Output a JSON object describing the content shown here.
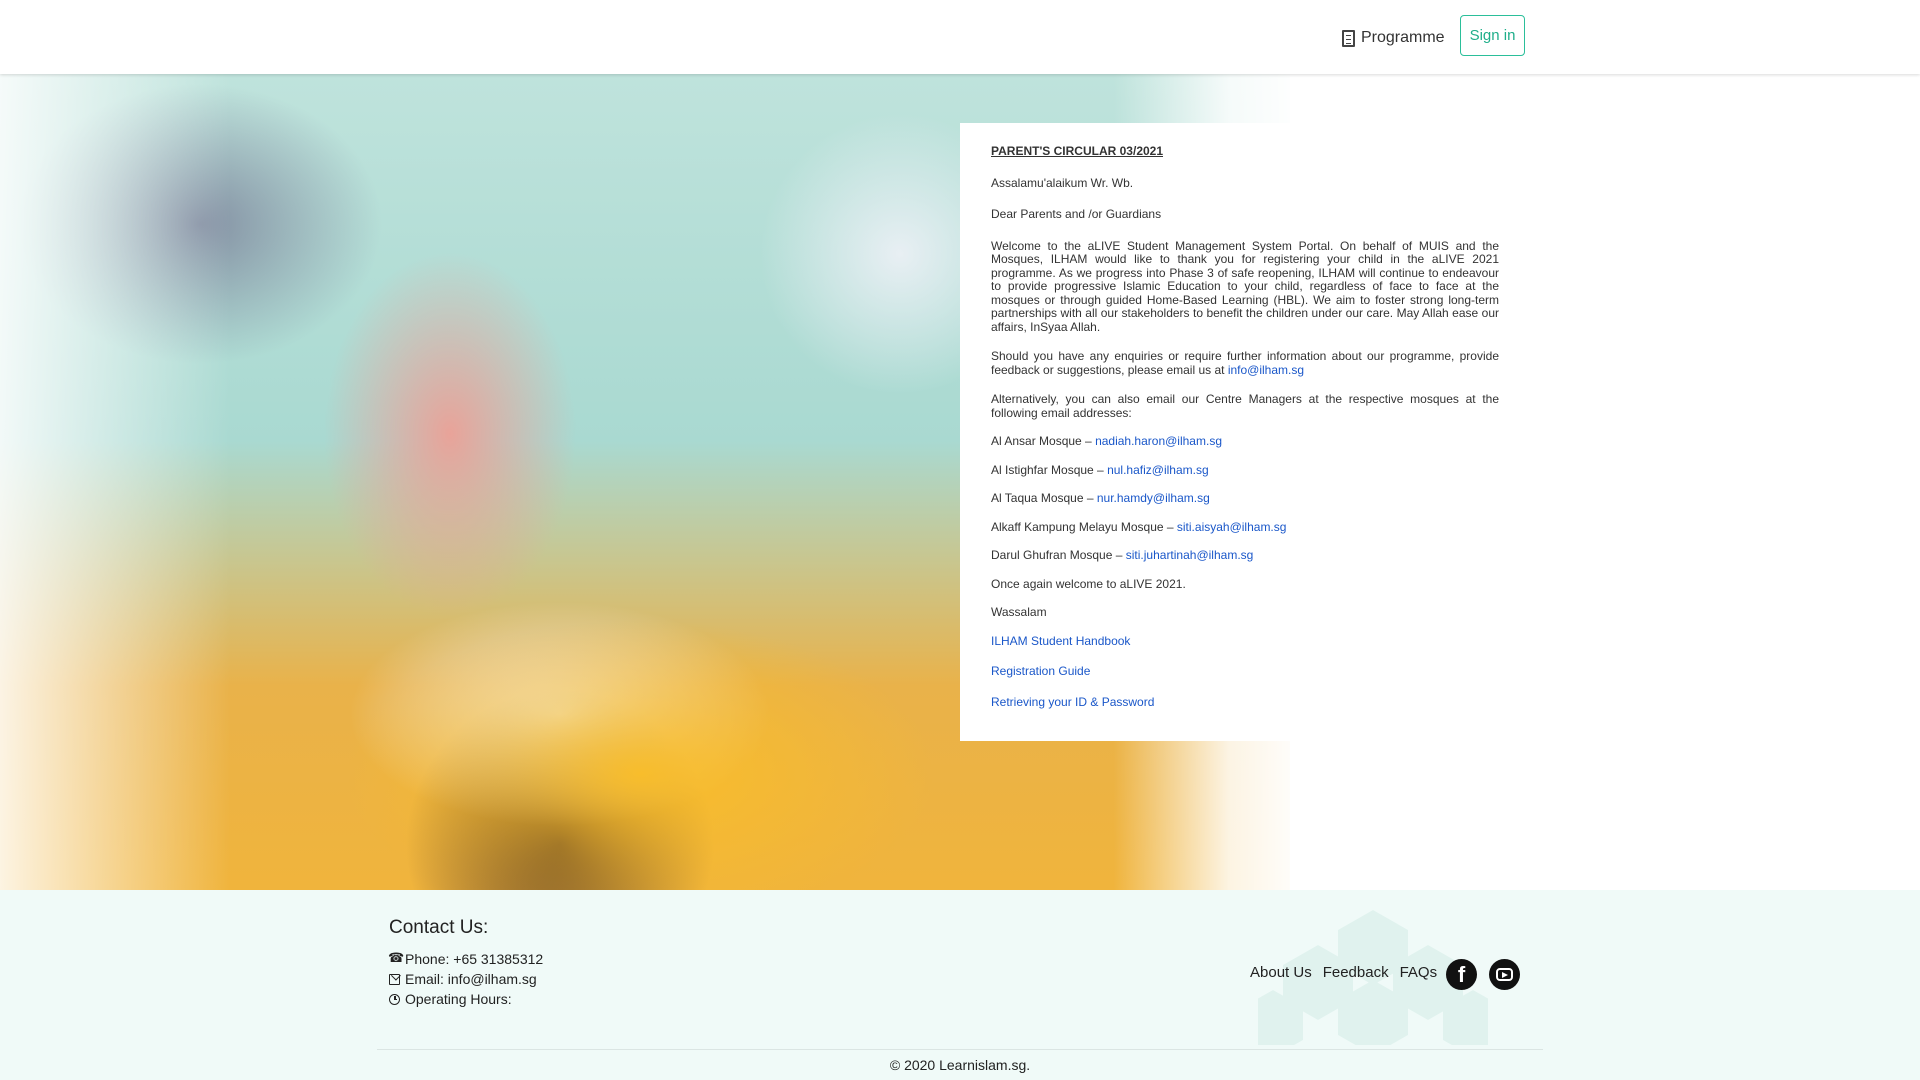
{
  "header": {
    "programme_label": "Programme",
    "signin_label": "Sign in"
  },
  "circular": {
    "title": "PARENT'S CIRCULAR 03/2021",
    "greeting": "Assalamu'alaikum Wr. Wb.",
    "salutation": "Dear Parents and /or Guardians",
    "body": "Welcome to the aLIVE Student Management System Portal. On behalf of MUIS and the Mosques, ILHAM would like to thank you for registering your child in the aLIVE 2021 programme. As we progress into Phase 3 of safe reopening, ILHAM will continue to endeavour to provide progressive Islamic Education to your child, regardless of face to face at the mosques or through guided Home-Based Learning (HBL). We aim to foster strong long-term partnerships with all our stakeholders to benefit the children under our care. May Allah ease our affairs, InSyaa Allah.",
    "enquiry_text": "Should you have any enquiries or require further information about our programme, provide feedback or suggestions, please email us at ",
    "enquiry_email": "info@ilham.sg",
    "alternative_text": "Alternatively, you can also email our Centre Managers at the respective mosques at the following email addresses:",
    "mosques": [
      {
        "name": "Al Ansar Mosque – ",
        "email": "nadiah.haron@ilham.sg"
      },
      {
        "name": "Al Istighfar Mosque – ",
        "email": "nul.hafiz@ilham.sg"
      },
      {
        "name": "Al Taqua Mosque – ",
        "email": "nur.hamdy@ilham.sg"
      },
      {
        "name": "Alkaff Kampung Melayu Mosque – ",
        "email": "siti.aisyah@ilham.sg"
      },
      {
        "name": "Darul Ghufran Mosque – ",
        "email": "siti.juhartinah@ilham.sg"
      }
    ],
    "welcome": "Once again welcome to aLIVE 2021.",
    "closing": "Wassalam",
    "documents": [
      "ILHAM Student Handbook",
      "Registration Guide",
      "Retrieving your ID & Password"
    ]
  },
  "footer": {
    "contact_title": "Contact Us:",
    "phone": "Phone: +65 31385312",
    "email": "Email: info@ilham.sg",
    "hours": "Operating Hours:",
    "links": [
      "About Us",
      "Feedback",
      "FAQs"
    ],
    "social": [
      "facebook-icon",
      "youtube-icon"
    ],
    "copyright": "© 2020 Learnislam.sg."
  },
  "colors": {
    "accent": "#1fae8a",
    "link": "#1a57c9",
    "footer_bg": "#f0faf8"
  }
}
